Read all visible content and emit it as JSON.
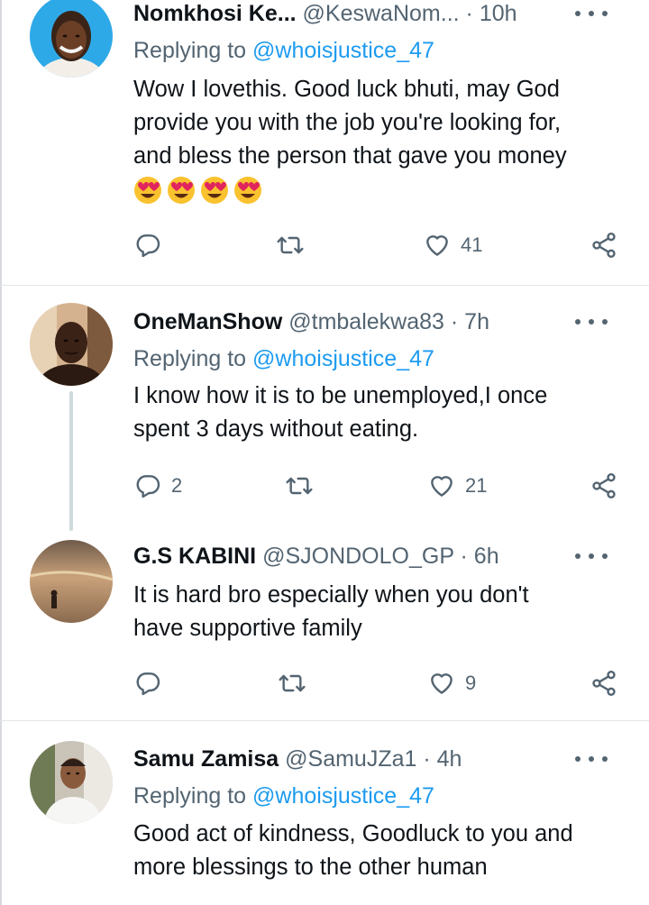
{
  "tweets": [
    {
      "name": "Nomkhosi Ke...",
      "handle": "@KeswaNom...",
      "dot": "·",
      "time": "10h",
      "replying_prefix": "Replying to ",
      "replying_to": "@whoisjustice_47",
      "text_lines": [
        "Wow I lovethis. Good luck bhuti, may God",
        "provide you with the job you're looking for,",
        "and bless the person that gave you money"
      ],
      "emoji": "heart-eyes-emoji",
      "emoji_count": 4,
      "replies": "",
      "likes": "41"
    },
    {
      "name": "OneManShow",
      "handle": "@tmbalekwa83",
      "dot": "·",
      "time": "7h",
      "replying_prefix": "Replying to ",
      "replying_to": "@whoisjustice_47",
      "text_lines": [
        "I know how it is to be unemployed,I once",
        "spent 3 days without eating."
      ],
      "replies": "2",
      "likes": "21"
    },
    {
      "name": "G.S KABINI",
      "handle": "@SJONDOLO_GP",
      "dot": "·",
      "time": "6h",
      "text_lines": [
        "It is hard bro especially when you don't",
        "have supportive family"
      ],
      "replies": "",
      "likes": "9"
    },
    {
      "name": "Samu Zamisa",
      "handle": "@SamuJZa1",
      "dot": "·",
      "time": "4h",
      "replying_prefix": "Replying to ",
      "replying_to": "@whoisjustice_47",
      "text_lines": [
        "Good act of kindness, Goodluck to you and",
        "more blessings to the other human"
      ]
    }
  ],
  "icons": {
    "reply": "reply-icon",
    "retweet": "retweet-icon",
    "like": "heart-icon",
    "share": "share-icon",
    "more": "more-icon"
  },
  "colors": {
    "text": "#0f1419",
    "secondary": "#536471",
    "link": "#1d9bf0",
    "divider": "#e3e6e8",
    "thread_line": "#cfd9de"
  }
}
